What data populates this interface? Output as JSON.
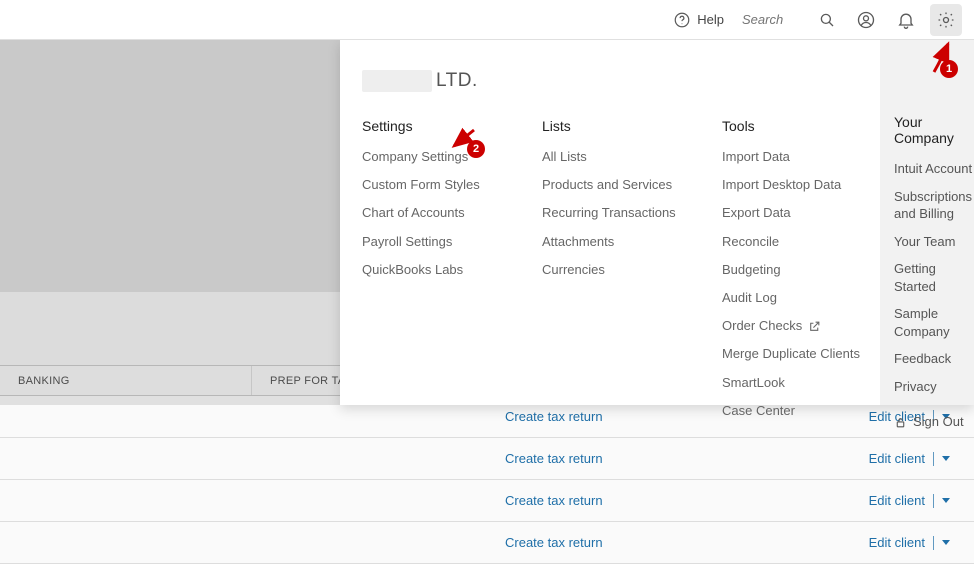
{
  "topbar": {
    "help_label": "Help",
    "search_placeholder": "Search"
  },
  "company": {
    "suffix": "LTD."
  },
  "settings_col": {
    "heading": "Settings",
    "items": [
      "Company Settings",
      "Custom Form Styles",
      "Chart of Accounts",
      "Payroll Settings",
      "QuickBooks Labs"
    ]
  },
  "lists_col": {
    "heading": "Lists",
    "items": [
      "All Lists",
      "Products and Services",
      "Recurring Transactions",
      "Attachments",
      "Currencies"
    ]
  },
  "tools_col": {
    "heading": "Tools",
    "items": [
      "Import Data",
      "Import Desktop Data",
      "Export Data",
      "Reconcile",
      "Budgeting",
      "Audit Log",
      "Order Checks",
      "Merge Duplicate Clients",
      "SmartLook",
      "Case Center"
    ]
  },
  "your_company_col": {
    "heading": "Your Company",
    "items": [
      "Intuit Account",
      "Subscriptions and Billing",
      "Your Team",
      "Getting Started",
      "Sample Company",
      "Feedback",
      "Privacy"
    ],
    "sign_out": "Sign Out"
  },
  "table": {
    "headers": {
      "banking": "BANKING",
      "prep": "PREP FOR TAX"
    },
    "row_action": "Create tax return",
    "row_edit": "Edit client"
  },
  "annotations": {
    "badge1": "1",
    "badge2": "2"
  }
}
